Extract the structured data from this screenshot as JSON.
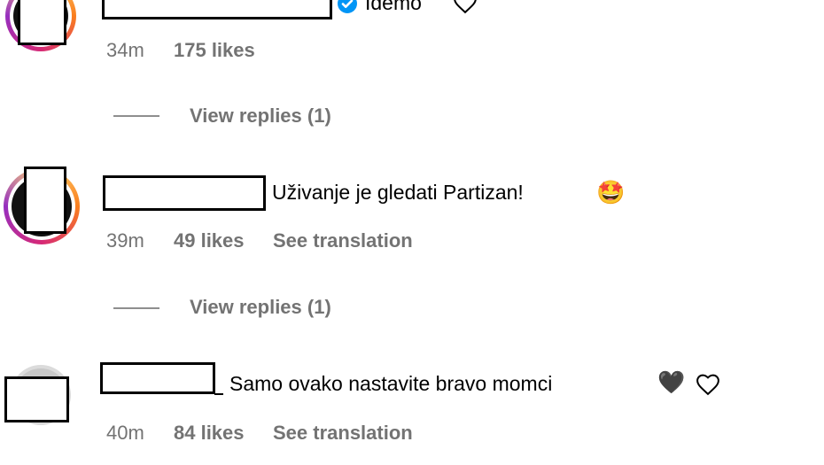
{
  "comments": [
    {
      "text": "Idemo",
      "time": "34m",
      "likes": "175 likes",
      "translate": "",
      "replies": "View replies (1)"
    },
    {
      "text": "Uživanje je gledati Partizan!",
      "emoji": "🤩",
      "time": "39m",
      "likes": "49 likes",
      "translate": "See translation",
      "replies": "View replies (1)"
    },
    {
      "text": "Samo ovako nastavite bravo momci",
      "emoji": "🖤",
      "time": "40m",
      "likes": "84 likes",
      "translate": "See translation"
    }
  ],
  "icons": {
    "verified": "verified-badge-icon",
    "like": "heart-outline-icon"
  },
  "colors": {
    "meta_gray": "#737373",
    "verified_blue": "#0095f6",
    "story_ring": [
      "#feda75",
      "#d62976",
      "#962fbf"
    ]
  }
}
